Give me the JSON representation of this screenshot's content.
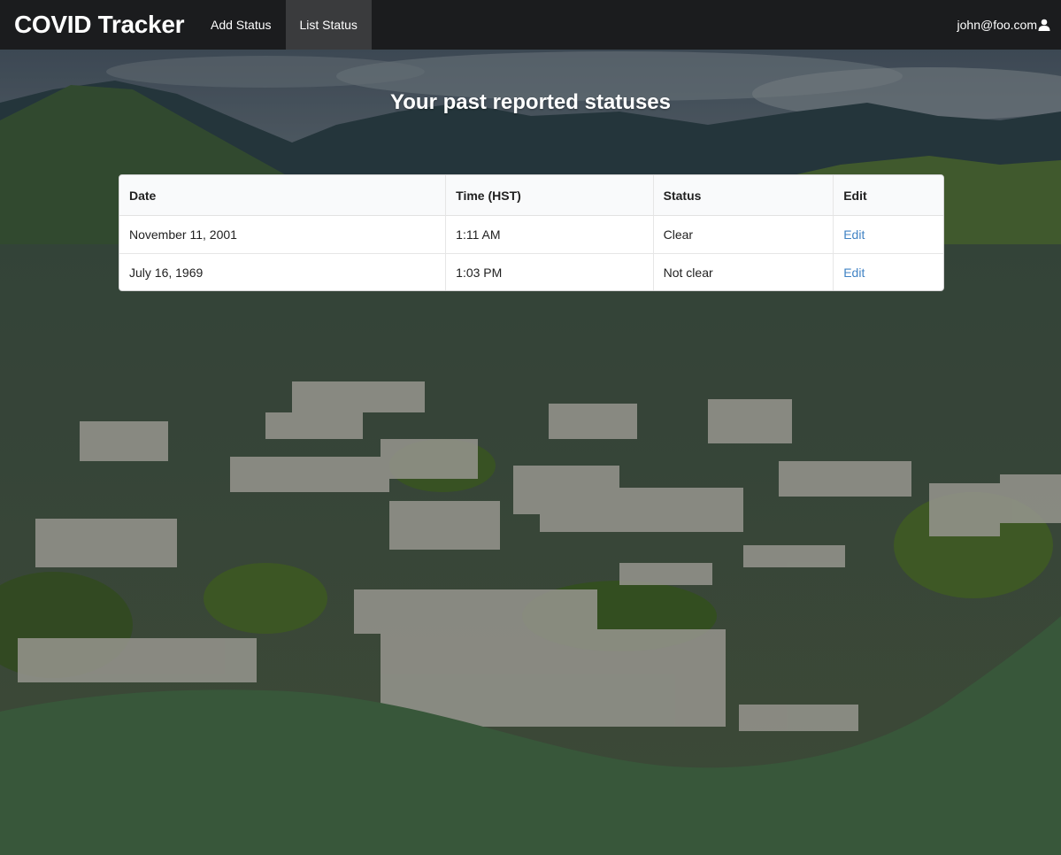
{
  "navbar": {
    "brand": "COVID Tracker",
    "links": [
      {
        "label": "Add Status",
        "active": false
      },
      {
        "label": "List Status",
        "active": true
      }
    ],
    "user": {
      "email": "john@foo.com",
      "icon": "user-icon"
    }
  },
  "page": {
    "title": "Your past reported statuses"
  },
  "table": {
    "headers": [
      "Date",
      "Time (HST)",
      "Status",
      "Edit"
    ],
    "rows": [
      {
        "date": "November 11, 2001",
        "time": "1:11 AM",
        "status": "Clear",
        "edit": "Edit"
      },
      {
        "date": "July 16, 1969",
        "time": "1:03 PM",
        "status": "Not clear",
        "edit": "Edit"
      }
    ]
  },
  "colors": {
    "navbar": "#1b1c1e",
    "nav_active": "#3a3b3d",
    "footer_wave": "#38573a",
    "link": "#4183c4"
  }
}
